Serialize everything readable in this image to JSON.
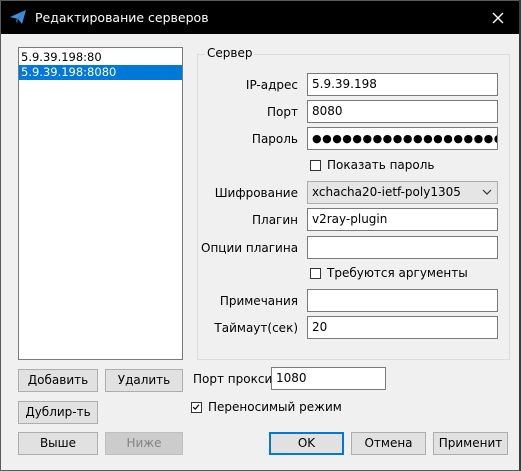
{
  "window": {
    "title": "Редактирование серверов",
    "icon": "paper-plane-icon",
    "close_icon": "close-icon"
  },
  "servers": {
    "items": [
      {
        "label": "5.9.39.198:80",
        "selected": false
      },
      {
        "label": "5.9.39.198:8080",
        "selected": true
      }
    ]
  },
  "server_group": {
    "title": "Сервер",
    "ip_label": "IP-адрес",
    "ip_value": "5.9.39.198",
    "port_label": "Порт",
    "port_value": "8080",
    "password_label": "Пароль",
    "password_value": "●●●●●●●●●●●●●●●●●●●●",
    "show_password_label": "Показать пароль",
    "show_password_checked": false,
    "encryption_label": "Шифрование",
    "encryption_value": "xchacha20-ietf-poly1305",
    "plugin_label": "Плагин",
    "plugin_value": "v2ray-plugin",
    "plugin_options_label": "Опции плагина",
    "plugin_options_value": "",
    "requires_args_label": "Требуются аргументы",
    "requires_args_checked": false,
    "notes_label": "Примечания",
    "notes_value": "",
    "timeout_label": "Таймаут(сек)",
    "timeout_value": "20"
  },
  "list_buttons": {
    "add": "Добавить",
    "delete": "Удалить",
    "duplicate": "Дублир-ть",
    "up": "Выше",
    "down": "Ниже"
  },
  "proxy": {
    "port_label": "Порт прокси",
    "port_value": "1080",
    "portable_label": "Переносимый режим",
    "portable_checked": true
  },
  "dialog_buttons": {
    "ok": "OK",
    "cancel": "Отмена",
    "apply": "Применит"
  },
  "colors": {
    "selection": "#0078d7",
    "titlebar": "#000000",
    "dialog_bg": "#f0f0f0"
  }
}
